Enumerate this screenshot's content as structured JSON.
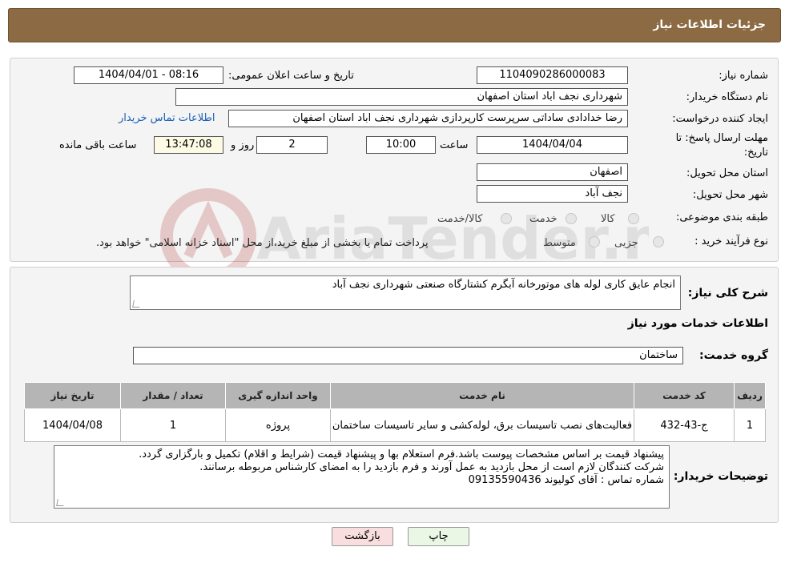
{
  "header": {
    "title": "جزئیات اطلاعات نیاز"
  },
  "fields": {
    "need_number_label": "شماره نیاز:",
    "need_number": "1104090286000083",
    "announce_label": "تاریخ و ساعت اعلان عمومی:",
    "announce_value": "1404/04/01 - 08:16",
    "buyer_org_label": "نام دستگاه خریدار:",
    "buyer_org": "شهرداری نجف اباد استان اصفهان",
    "requester_label": "ایجاد کننده درخواست:",
    "requester": "رضا خدادادی ساداتی سرپرست  کارپردازی شهرداری نجف اباد استان اصفهان",
    "contact_link": "اطلاعات تماس خریدار",
    "deadline_label_1": "مهلت ارسال پاسخ: تا",
    "deadline_label_2": "تاریخ:",
    "deadline_date": "1404/04/04",
    "time_label": "ساعت",
    "deadline_time": "10:00",
    "days": "2",
    "days_label": "روز و",
    "remaining_time": "13:47:08",
    "remaining_label": "ساعت باقی مانده",
    "province_label": "استان محل تحویل:",
    "province": "اصفهان",
    "city_label": "شهر محل تحویل:",
    "city": "نجف آباد",
    "category_label": "طبقه بندی موضوعی:",
    "category_options": [
      "کالا",
      "خدمت",
      "کالا/خدمت"
    ],
    "process_label": "نوع فرآیند خرید :",
    "process_options": [
      "جزیی",
      "متوسط"
    ],
    "process_note": "پرداخت تمام یا بخشی از مبلغ خرید،از محل \"اسناد خزانه اسلامی\" خواهد بود."
  },
  "summary": {
    "label": "شرح کلی نیاز:",
    "text": "انجام عایق کاری لوله های موتورخانه آبگرم کشتارگاه صنعتی شهرداری نجف آباد"
  },
  "services": {
    "section_title": "اطلاعات خدمات مورد نیاز",
    "group_label": "گروه خدمت:",
    "group_value": "ساختمان",
    "columns": [
      "ردیف",
      "کد خدمت",
      "نام خدمت",
      "واحد اندازه گیری",
      "تعداد / مقدار",
      "تاریخ نیاز"
    ],
    "rows": [
      {
        "row": "1",
        "code": "ج-43-432",
        "name": "فعالیت‌های نصب تاسیسات برق، لوله‌کشی و سایر تاسیسات ساختمان",
        "unit": "پروژه",
        "qty": "1",
        "date": "1404/04/08"
      }
    ]
  },
  "buyer_notes": {
    "label": "توضیحات خریدار:",
    "line1": "پیشنهاد قیمت بر اساس مشخصات پیوست باشد.فرم استعلام بها و پیشنهاد قیمت (شرایط و اقلام) تکمیل و بارگزاری گردد.",
    "line2": "شرکت کنندگان لازم است از محل بازدید به عمل آورند و فرم بازدید را به امضای کارشناس مربوطه برسانند.",
    "line3": "شماره تماس : آقای کولیوند 09135590436"
  },
  "buttons": {
    "print": "چاپ",
    "back": "بازگشت"
  },
  "watermark": {
    "text": "AriaTender.neT"
  },
  "colors": {
    "header": "#8c6a43",
    "link": "#1a5fb4",
    "print_btn": "#eaf7e4",
    "back_btn": "#f8dede"
  }
}
